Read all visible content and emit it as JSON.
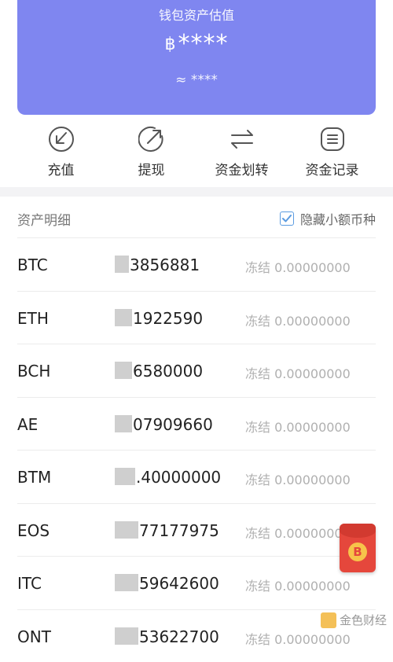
{
  "hero": {
    "title": "钱包资产估值",
    "currency_symbol": "฿",
    "amount": "****",
    "sub_amount": "≈ ****",
    "color": "#7f86f0"
  },
  "actions": [
    {
      "label": "充值",
      "icon": "deposit-icon"
    },
    {
      "label": "提现",
      "icon": "withdraw-icon"
    },
    {
      "label": "资金划转",
      "icon": "transfer-icon"
    },
    {
      "label": "资金记录",
      "icon": "records-icon"
    }
  ],
  "section": {
    "title": "资产明细",
    "hide_small_label": "隐藏小额币种",
    "hide_small_checked": true
  },
  "assets": [
    {
      "coin": "BTC",
      "balance_visible": "3856881",
      "frozen": "冻结 0.00000000"
    },
    {
      "coin": "ETH",
      "balance_visible": "1922590",
      "frozen": "冻结 0.00000000"
    },
    {
      "coin": "BCH",
      "balance_visible": "6580000",
      "frozen": "冻结 0.00000000"
    },
    {
      "coin": "AE",
      "balance_visible": "07909660",
      "frozen": "冻结 0.00000000"
    },
    {
      "coin": "BTM",
      "balance_visible": ".40000000",
      "frozen": "冻结 0.00000000"
    },
    {
      "coin": "EOS",
      "balance_visible": "77177975",
      "frozen": "冻结 0.00000000"
    },
    {
      "coin": "ITC",
      "balance_visible": "59642600",
      "frozen": "冻结 0.00000000"
    },
    {
      "coin": "ONT",
      "balance_visible": "53622700",
      "frozen": "冻结 0.00000000"
    }
  ],
  "floating": {
    "icon": "red-packet-icon",
    "mark": "B"
  },
  "watermark": {
    "text": "金色财经"
  }
}
